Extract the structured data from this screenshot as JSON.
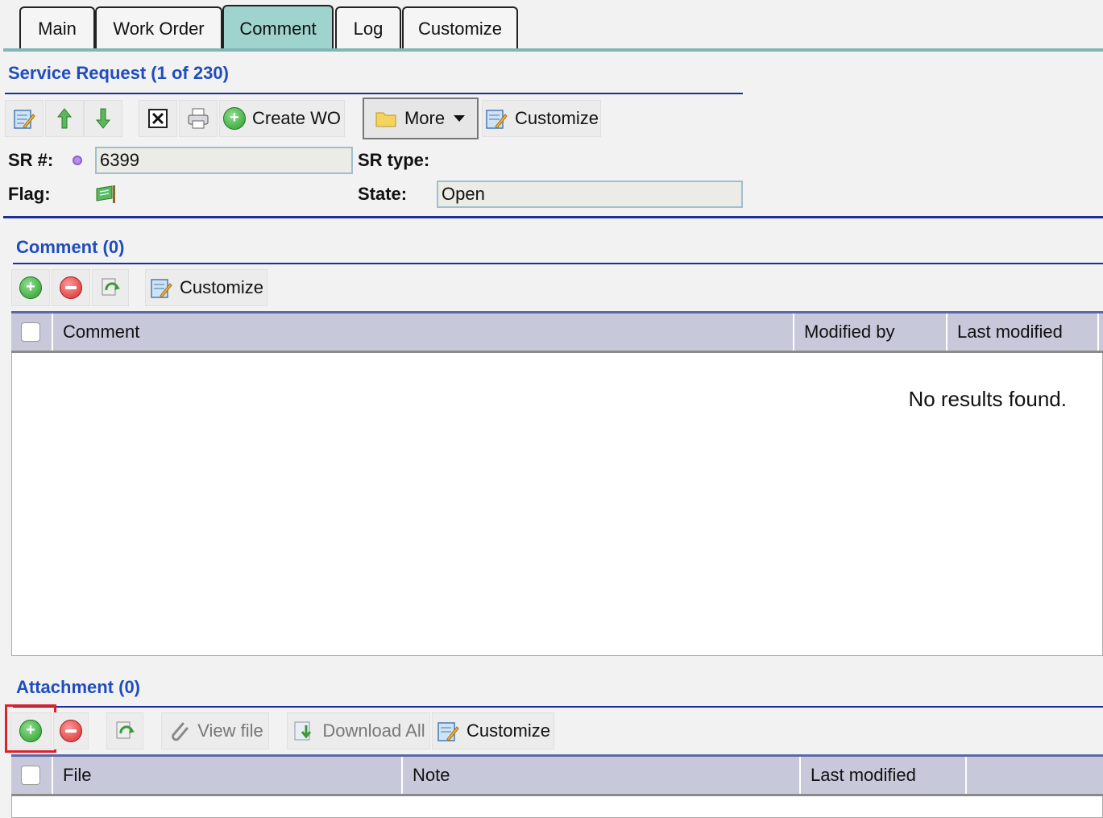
{
  "tabs": [
    "Main",
    "Work Order",
    "Comment",
    "Log",
    "Customize"
  ],
  "active_tab": "Comment",
  "service_request": {
    "title": "Service Request (1 of 230)",
    "toolbar": {
      "create_wo": "Create WO",
      "more": "More",
      "customize": "Customize"
    },
    "sr_number_label": "SR #:",
    "sr_number_value": "6399",
    "sr_type_label": "SR type:",
    "flag_label": "Flag:",
    "state_label": "State:",
    "state_value": "Open"
  },
  "comment": {
    "title": "Comment (0)",
    "customize": "Customize",
    "columns": [
      "Comment",
      "Modified by",
      "Last modified"
    ],
    "empty_text": "No results found."
  },
  "attachment": {
    "title": "Attachment (0)",
    "view_file": "View file",
    "download_all": "Download All",
    "customize": "Customize",
    "columns": [
      "File",
      "Note",
      "Last modified"
    ]
  },
  "colors": {
    "section_title": "#1f4dbf",
    "active_tab": "#9fd3cd",
    "grid_header": "#c7c8da",
    "highlight_box": "#d9232d"
  }
}
